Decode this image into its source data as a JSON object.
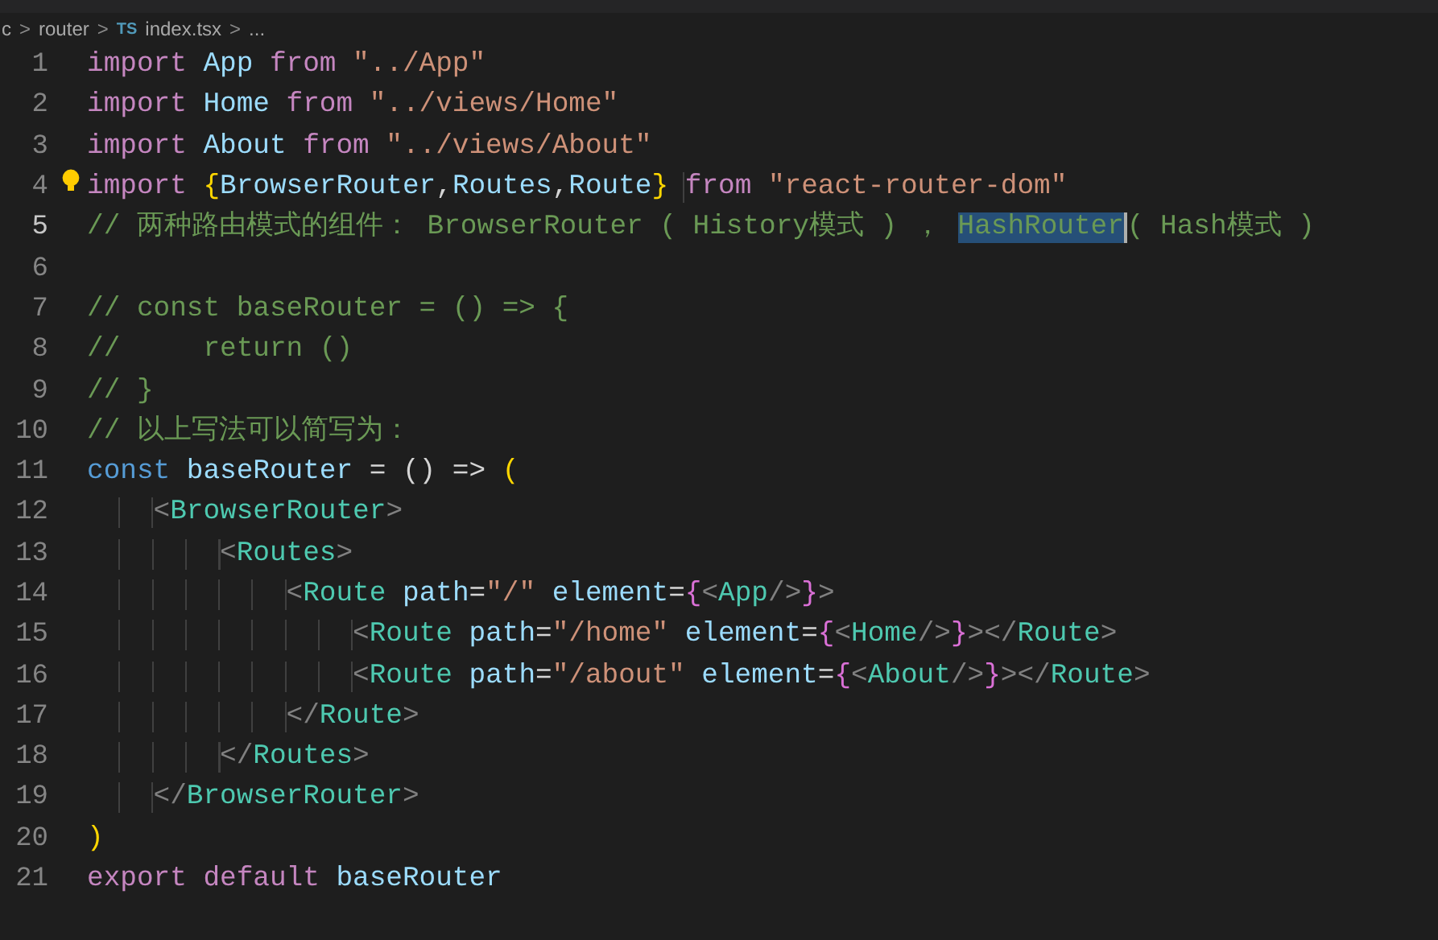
{
  "breadcrumb": [
    {
      "kind": "text",
      "text": "c"
    },
    {
      "kind": "sep",
      "text": ">"
    },
    {
      "kind": "text",
      "text": "router"
    },
    {
      "kind": "sep",
      "text": ">"
    },
    {
      "kind": "ts",
      "text": "TS"
    },
    {
      "kind": "text",
      "text": "index.tsx"
    },
    {
      "kind": "sep",
      "text": ">"
    },
    {
      "kind": "text",
      "text": "..."
    }
  ],
  "lines": [
    {
      "number": "1",
      "current": false,
      "tokens": [
        {
          "kind": "kw",
          "t": "import "
        },
        {
          "kind": "id",
          "t": "App "
        },
        {
          "kind": "kw",
          "t": "from "
        },
        {
          "kind": "str",
          "t": "\"../App\""
        }
      ]
    },
    {
      "number": "2",
      "current": false,
      "tokens": [
        {
          "kind": "kw",
          "t": "import "
        },
        {
          "kind": "id",
          "t": "Home "
        },
        {
          "kind": "kw",
          "t": "from "
        },
        {
          "kind": "str",
          "t": "\"../views/Home\""
        }
      ]
    },
    {
      "number": "3",
      "current": false,
      "tokens": [
        {
          "kind": "kw",
          "t": "import "
        },
        {
          "kind": "id",
          "t": "About "
        },
        {
          "kind": "kw",
          "t": "from "
        },
        {
          "kind": "str",
          "t": "\"../views/About\""
        }
      ]
    },
    {
      "number": "4",
      "current": false,
      "hint": true,
      "tokens": [
        {
          "kind": "kw",
          "t": "import "
        },
        {
          "kind": "brace",
          "t": "{"
        },
        {
          "kind": "id",
          "t": "BrowserRouter"
        },
        {
          "kind": "punc",
          "t": ","
        },
        {
          "kind": "id",
          "t": "Routes"
        },
        {
          "kind": "punc",
          "t": ","
        },
        {
          "kind": "id",
          "t": "Route"
        },
        {
          "kind": "brace",
          "t": "}"
        },
        {
          "kind": "kw",
          "t": " from "
        },
        {
          "kind": "str",
          "t": "\"react-router-dom\""
        }
      ]
    },
    {
      "number": "5",
      "current": true,
      "tokens": [
        {
          "kind": "cmt",
          "t": "// 两种路由模式的组件： BrowserRouter ( History模式 ) ， "
        },
        {
          "kind": "sel",
          "t": "HashRouter"
        },
        {
          "kind": "cmt",
          "t": "( Hash模式 )"
        }
      ]
    },
    {
      "number": "6",
      "current": false
    },
    {
      "number": "7",
      "current": false,
      "tokens": [
        {
          "kind": "cmt",
          "t": "// const baseRouter = () => {"
        }
      ]
    },
    {
      "number": "8",
      "current": false,
      "tokens": [
        {
          "kind": "cmt",
          "t": "//     return ()"
        }
      ]
    },
    {
      "number": "9",
      "current": false,
      "tokens": [
        {
          "kind": "cmt",
          "t": "// }"
        }
      ]
    },
    {
      "number": "10",
      "current": false,
      "tokens": [
        {
          "kind": "cmt",
          "t": "// 以上写法可以简写为："
        }
      ]
    },
    {
      "number": "11",
      "current": false,
      "tokens": [
        {
          "kind": "storage",
          "t": "const "
        },
        {
          "kind": "id",
          "t": "baseRouter "
        },
        {
          "kind": "punc",
          "t": "= () => "
        },
        {
          "kind": "brace",
          "t": "("
        }
      ]
    },
    {
      "number": "12",
      "current": false,
      "tokens": [
        {
          "kind": "tag",
          "t": "    <"
        },
        {
          "kind": "comp",
          "t": "BrowserRouter"
        },
        {
          "kind": "tag",
          "t": ">"
        }
      ]
    },
    {
      "number": "13",
      "current": false,
      "tokens": [
        {
          "kind": "tag",
          "t": "        <"
        },
        {
          "kind": "comp",
          "t": "Routes"
        },
        {
          "kind": "tag",
          "t": ">"
        }
      ]
    },
    {
      "number": "14",
      "current": false,
      "tokens": [
        {
          "kind": "tag",
          "t": "            <"
        },
        {
          "kind": "comp",
          "t": "Route "
        },
        {
          "kind": "id",
          "t": "path"
        },
        {
          "kind": "punc",
          "t": "="
        },
        {
          "kind": "str",
          "t": "\"/\" "
        },
        {
          "kind": "id",
          "t": "element"
        },
        {
          "kind": "punc",
          "t": "="
        },
        {
          "kind": "brace2",
          "t": "{"
        },
        {
          "kind": "tag",
          "t": "<"
        },
        {
          "kind": "comp",
          "t": "App"
        },
        {
          "kind": "tag",
          "t": "/>"
        },
        {
          "kind": "brace2",
          "t": "}"
        },
        {
          "kind": "tag",
          "t": ">"
        }
      ]
    },
    {
      "number": "15",
      "current": false,
      "tokens": [
        {
          "kind": "tag",
          "t": "                <"
        },
        {
          "kind": "comp",
          "t": "Route "
        },
        {
          "kind": "id",
          "t": "path"
        },
        {
          "kind": "punc",
          "t": "="
        },
        {
          "kind": "str",
          "t": "\"/home\" "
        },
        {
          "kind": "id",
          "t": "element"
        },
        {
          "kind": "punc",
          "t": "="
        },
        {
          "kind": "brace2",
          "t": "{"
        },
        {
          "kind": "tag",
          "t": "<"
        },
        {
          "kind": "comp",
          "t": "Home"
        },
        {
          "kind": "tag",
          "t": "/>"
        },
        {
          "kind": "brace2",
          "t": "}"
        },
        {
          "kind": "tag",
          "t": "></"
        },
        {
          "kind": "comp",
          "t": "Route"
        },
        {
          "kind": "tag",
          "t": ">"
        }
      ]
    },
    {
      "number": "16",
      "current": false,
      "tokens": [
        {
          "kind": "tag",
          "t": "                <"
        },
        {
          "kind": "comp",
          "t": "Route "
        },
        {
          "kind": "id",
          "t": "path"
        },
        {
          "kind": "punc",
          "t": "="
        },
        {
          "kind": "str",
          "t": "\"/about\" "
        },
        {
          "kind": "id",
          "t": "element"
        },
        {
          "kind": "punc",
          "t": "="
        },
        {
          "kind": "brace2",
          "t": "{"
        },
        {
          "kind": "tag",
          "t": "<"
        },
        {
          "kind": "comp",
          "t": "About"
        },
        {
          "kind": "tag",
          "t": "/>"
        },
        {
          "kind": "brace2",
          "t": "}"
        },
        {
          "kind": "tag",
          "t": "></"
        },
        {
          "kind": "comp",
          "t": "Route"
        },
        {
          "kind": "tag",
          "t": ">"
        }
      ]
    },
    {
      "number": "17",
      "current": false,
      "tokens": [
        {
          "kind": "tag",
          "t": "            </"
        },
        {
          "kind": "comp",
          "t": "Route"
        },
        {
          "kind": "tag",
          "t": ">"
        }
      ]
    },
    {
      "number": "18",
      "current": false,
      "tokens": [
        {
          "kind": "tag",
          "t": "        </"
        },
        {
          "kind": "comp",
          "t": "Routes"
        },
        {
          "kind": "tag",
          "t": ">"
        }
      ]
    },
    {
      "number": "19",
      "current": false,
      "tokens": [
        {
          "kind": "tag",
          "t": "    </"
        },
        {
          "kind": "comp",
          "t": "BrowserRouter"
        },
        {
          "kind": "tag",
          "t": ">"
        }
      ]
    },
    {
      "number": "20",
      "current": false,
      "tokens": [
        {
          "kind": "brace",
          "t": ")"
        }
      ]
    },
    {
      "number": "21",
      "current": false,
      "tokens": [
        {
          "kind": "kw",
          "t": "export default "
        },
        {
          "kind": "id",
          "t": "baseRouter"
        }
      ]
    }
  ]
}
